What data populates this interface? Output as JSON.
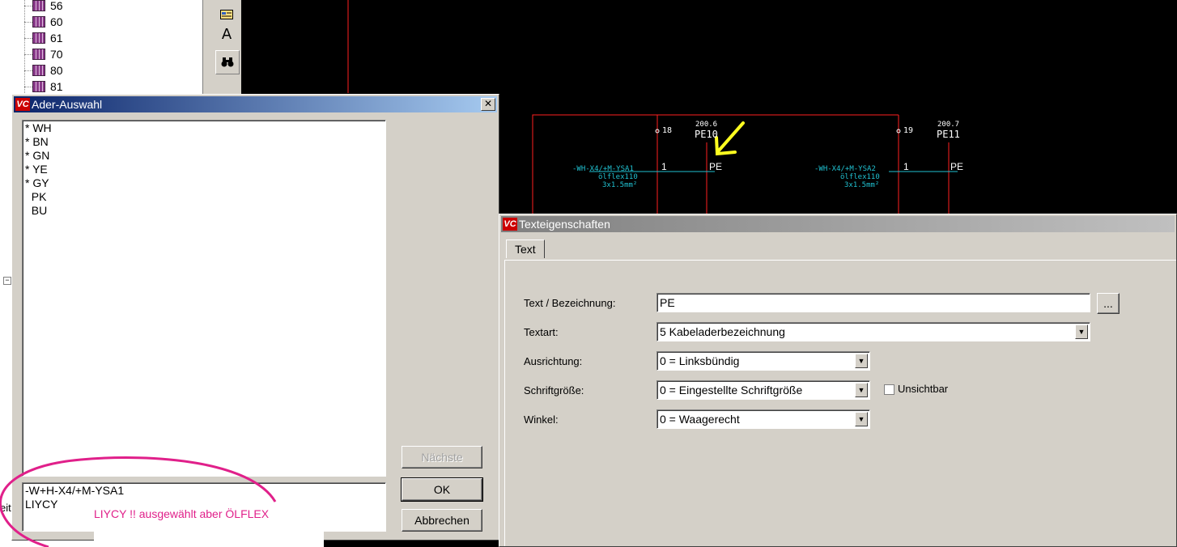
{
  "tree": {
    "items": [
      "56",
      "60",
      "61",
      "70",
      "80",
      "81"
    ]
  },
  "toolbar": {
    "buttons": [
      {
        "icon": "table-insert-icon"
      },
      {
        "icon": "text-tool-icon",
        "glyph": "A"
      },
      {
        "icon": "binoculars-icon",
        "glyph": "⚲"
      }
    ]
  },
  "cad": {
    "left_group": {
      "top_terminal": "18",
      "ref_code": "200.6",
      "pe_label": "PE10",
      "cable_name": "-WH-X4/+M-YSA1",
      "cable_type": "ölflex110",
      "cable_spec": "3x1.5mm²",
      "wire_number": "1",
      "wire_pe": "PE"
    },
    "right_group": {
      "top_terminal": "19",
      "ref_code": "200.7",
      "pe_label": "PE11",
      "cable_name": "-WH-X4/+M-YSA2",
      "cable_type": "ölflex110",
      "cable_spec": "3x1.5mm²",
      "wire_number": "1",
      "wire_pe": "PE"
    },
    "colors": {
      "line": "#ff2020",
      "cable": "#20c0d0",
      "label": "#ffffff",
      "arrow": "#ffff20"
    }
  },
  "ader_dialog": {
    "title": "Ader-Auswahl",
    "close_glyph": "✕",
    "wires": [
      "* WH",
      "* BN",
      "* GN",
      "* YE",
      "* GY",
      "  PK",
      "  BU"
    ],
    "info_lines": [
      "-W+H-X4/+M-YSA1",
      "LIYCY"
    ],
    "next_button": "Nächste",
    "ok_button": "OK",
    "cancel_button": "Abbrechen"
  },
  "annotation": {
    "text": "LIYCY !! ausgewählt aber ÖLFLEX",
    "color": "#e0208a"
  },
  "text_dialog": {
    "title": "Texteigenschaften",
    "tab": "Text",
    "fields": {
      "text_label": "Text / Bezeichnung:",
      "text_value": "PE",
      "ellipsis": "...",
      "textart_label": "Textart:",
      "textart_value": "5 Kabeladerbezeichnung",
      "ausrichtung_label": "Ausrichtung:",
      "ausrichtung_value": "0 = Linksbündig",
      "schrift_label": "Schriftgröße:",
      "schrift_value": "0 = Eingestellte Schriftgröße",
      "unsichtbar_label": "Unsichtbar",
      "winkel_label": "Winkel:",
      "winkel_value": "0 = Waagerecht"
    }
  },
  "statusbar_fragment": "eit"
}
